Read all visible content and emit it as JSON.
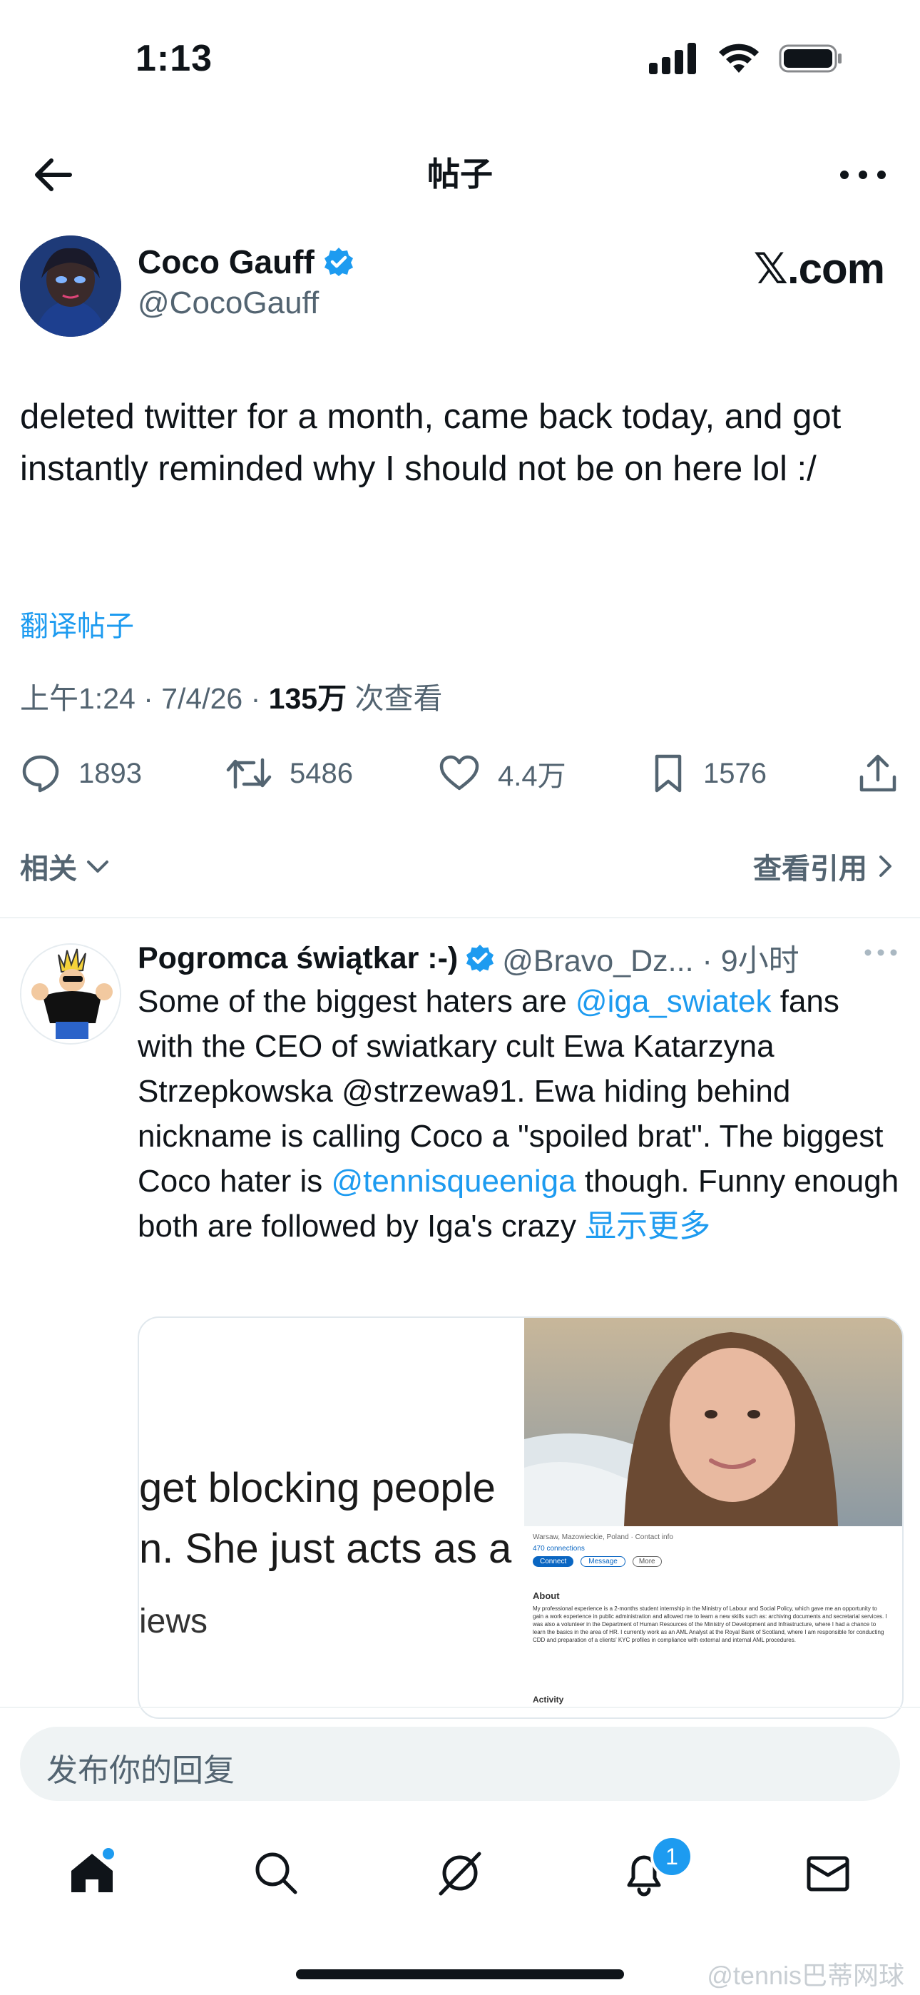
{
  "status_bar": {
    "time": "1:13"
  },
  "header": {
    "title": "帖子"
  },
  "post": {
    "author_name": "Coco Gauff",
    "author_handle": "@CocoGauff",
    "site_logo": "𝕏.com",
    "text": "deleted twitter for a month, came back today, and got instantly reminded why I should not be on here lol :/",
    "translate": "翻译帖子",
    "time_date": "上午1:24 · 7/4/26 · ",
    "views_count": "135万",
    "views_label": " 次查看",
    "replies": "1893",
    "reposts": "5486",
    "likes": "4.4万",
    "bookmarks": "1576"
  },
  "related": {
    "label": "相关",
    "quotes": "查看引用"
  },
  "reply": {
    "name": "Pogromca świątkar :-)",
    "meta": "@Bravo_Dz... · 9小时",
    "text_before_1": "Some of the biggest haters are ",
    "mention_1": "@iga_swiatek",
    "text_before_2": " fans with the CEO of swiatkary cult Ewa Katarzyna Strzepkowska @strzewa91. Ewa hiding behind nickname is calling Coco a \"spoiled brat\". The biggest Coco hater is ",
    "mention_2": "@tennisqueeniga",
    "text_after": " though. Funny enough both are followed by Iga's crazy ",
    "show_more": "显示更多",
    "media_line_1": "get blocking people",
    "media_line_2": "n. She just acts as a",
    "media_line_3": "iews",
    "profile_location": "Warsaw, Mazowieckie, Poland · Contact info",
    "profile_connections": "470 connections",
    "profile_connect": "Connect",
    "profile_message": "Message",
    "profile_more": "More",
    "profile_about_title": "About",
    "profile_about_text": "My professional experience is a 2-months student internship in the Ministry of Labour and Social Policy, which gave me an opportunity to gain a work experience in public administration and allowed me to learn a new skills such as: archiving documents and secretarial services. I was also a volunteer in the Department of Human Resources of the Ministry of Development and Infrastructure, where I had a chance to learn the basics in the area of HR. I currently work as an AML Analyst at the Royal Bank of Scotland, where I am responsible for conducting CDD and preparation of a clients' KYC profiles in compliance with external and internal AML procedures.",
    "profile_activity": "Activity"
  },
  "composer": {
    "placeholder": "发布你的回复"
  },
  "tab_bar": {
    "notification_count": "1"
  },
  "watermark": "@tennis巴蒂网球",
  "colors": {
    "accent": "#1d9bf0",
    "text": "#0f1419",
    "muted": "#536471"
  }
}
